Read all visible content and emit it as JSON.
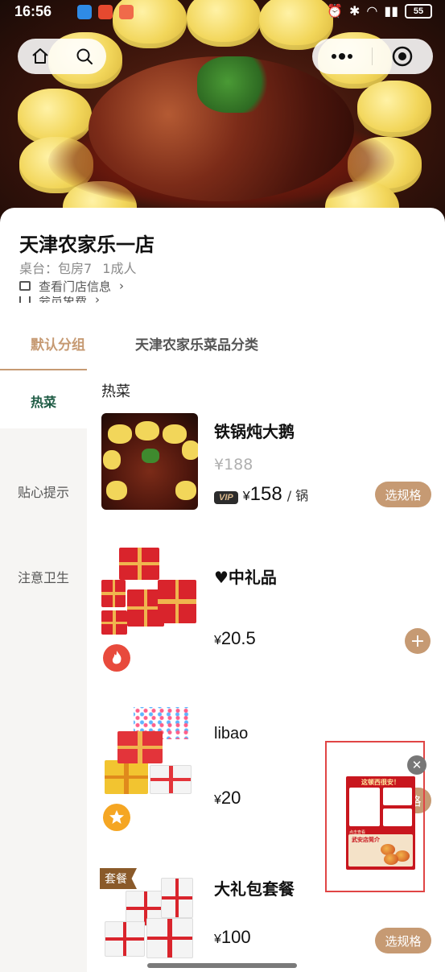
{
  "status_bar": {
    "time": "16:56",
    "battery": "55"
  },
  "shop": {
    "name": "天津农家乐一店",
    "table_info": "桌台：包房7",
    "party_size": "1成人",
    "link_store_info": "查看门店信息",
    "link_member": "会员免费"
  },
  "tabs": [
    {
      "label": "默认分组",
      "active": true
    },
    {
      "label": "天津农家乐菜品分类",
      "active": false
    }
  ],
  "categories": [
    {
      "label": "热菜",
      "active": true
    },
    {
      "label": "贴心提示",
      "active": false
    },
    {
      "label": "注意卫生",
      "active": false
    }
  ],
  "section_title": "热菜",
  "items": [
    {
      "name": "铁锅炖大鹅",
      "original_price": "¥188",
      "vip_badge": "VIP",
      "vip_currency": "¥",
      "vip_price": "158",
      "unit": "/ 锅",
      "action": "选规格",
      "image": "goose-stew"
    },
    {
      "name": "♥中礼品",
      "currency": "¥",
      "price": "20.5",
      "action": "+",
      "badge": "hot-flame-icon",
      "image": "red-gift-boxes"
    },
    {
      "name": "libao",
      "currency": "¥",
      "price": "20",
      "action": "选规格",
      "badge": "star-icon",
      "image": "gold-gift-boxes"
    },
    {
      "name": "大礼包套餐",
      "currency": "¥",
      "price": "100",
      "action": "选规格",
      "tag": "套餐",
      "image": "white-gift-boxes"
    }
  ],
  "promo": {
    "title": "这顿西很安！",
    "banner_title": "武安店简介",
    "sub": "点击查看"
  },
  "colors": {
    "accent": "#c69a73",
    "category_active": "#1e5b44",
    "promo_border": "#e04545"
  }
}
